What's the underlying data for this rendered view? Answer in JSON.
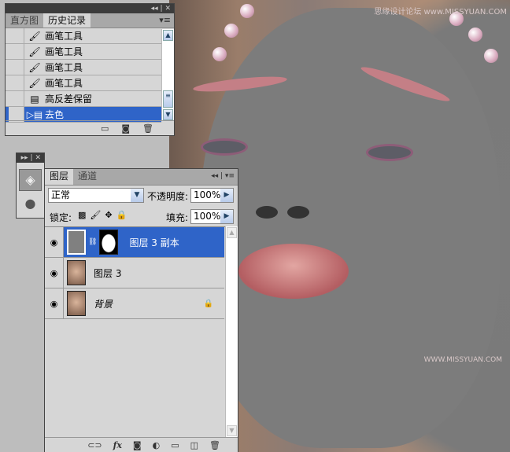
{
  "watermark": {
    "top": "思缘设计论坛 www.MISSYUAN.COM",
    "bottom": "WWW.MISSYUAN.COM"
  },
  "history_panel": {
    "title_controls": "◂◂ | ✕",
    "tabs": [
      {
        "label": "直方图",
        "active": false
      },
      {
        "label": "历史记录",
        "active": true
      }
    ],
    "items": [
      {
        "label": "画笔工具",
        "icon": "brush-icon",
        "selected": false
      },
      {
        "label": "画笔工具",
        "icon": "brush-icon",
        "selected": false
      },
      {
        "label": "画笔工具",
        "icon": "brush-icon",
        "selected": false
      },
      {
        "label": "画笔工具",
        "icon": "brush-icon",
        "selected": false
      },
      {
        "label": "高反差保留",
        "icon": "document-icon",
        "selected": false
      },
      {
        "label": "去色",
        "icon": "document-icon",
        "selected": true
      }
    ],
    "footer_icons": [
      "new-document-icon",
      "camera-icon",
      "trash-icon"
    ]
  },
  "dock": {
    "controls": "▸▸ | ✕",
    "icons": [
      "layers-icon",
      "channels-icon"
    ]
  },
  "layers_panel": {
    "tabs": [
      {
        "label": "图层",
        "active": true
      },
      {
        "label": "通道",
        "active": false
      }
    ],
    "blend_mode": "正常",
    "opacity_label": "不透明度:",
    "opacity": "100%",
    "lock_label": "锁定:",
    "fill_label": "填充:",
    "fill": "100%",
    "layers": [
      {
        "name": "图层 3 副本",
        "selected": true,
        "visible": true,
        "has_mask": true,
        "locked": false,
        "thumb_color": "#808080"
      },
      {
        "name": "图层 3",
        "selected": false,
        "visible": true,
        "has_mask": false,
        "locked": false,
        "thumb_color": "#a07a60"
      },
      {
        "name": "背景",
        "selected": false,
        "visible": true,
        "has_mask": false,
        "locked": true,
        "thumb_color": "#a07a60"
      }
    ],
    "footer_icons": [
      "link-icon",
      "fx-icon",
      "mask-icon",
      "adjustment-icon",
      "group-icon",
      "new-layer-icon",
      "trash-icon"
    ],
    "fx_label": "fx"
  }
}
